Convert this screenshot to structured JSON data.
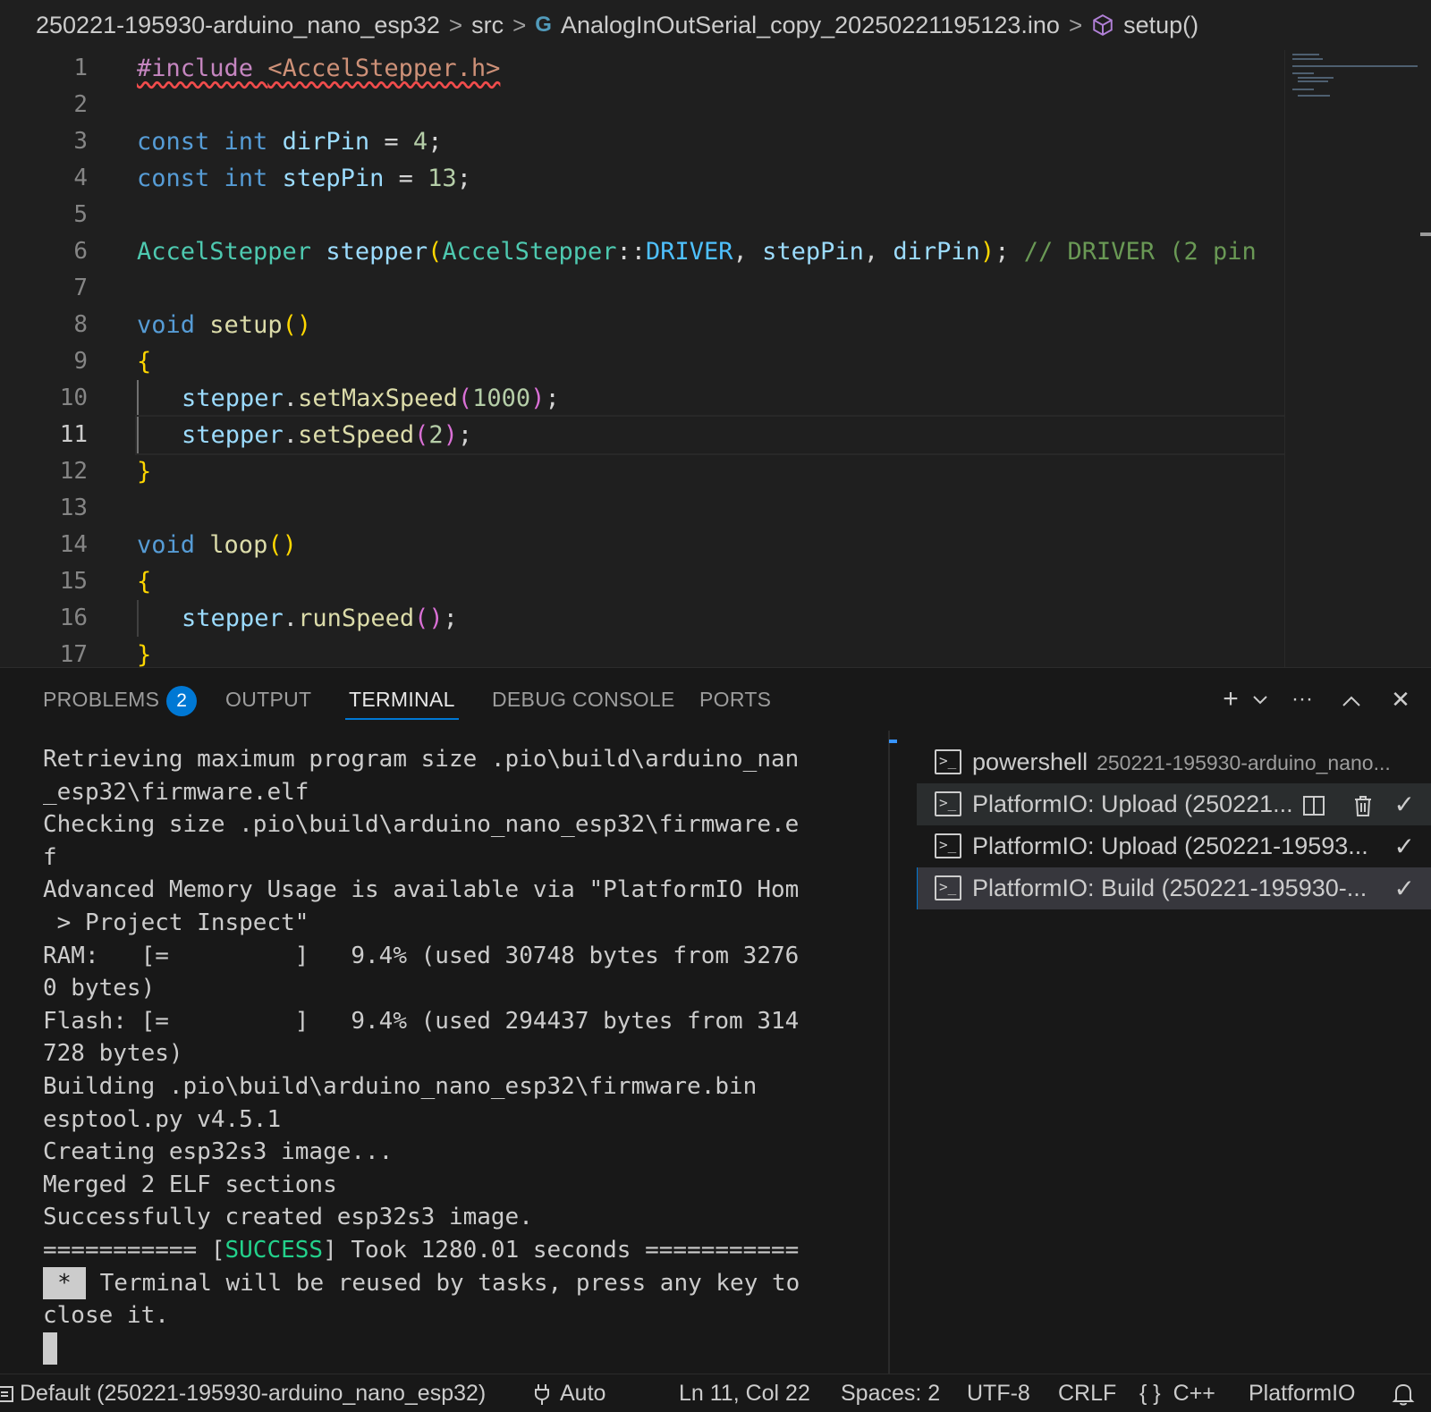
{
  "breadcrumb": {
    "folder": "250221-195930-arduino_nano_esp32",
    "src": "src",
    "file": "AnalogInOutSerial_copy_20250221195123.ino",
    "symbol": "setup()",
    "separator": ">"
  },
  "editor": {
    "line_numbers": [
      "1",
      "2",
      "3",
      "4",
      "5",
      "6",
      "7",
      "8",
      "9",
      "10",
      "11",
      "12",
      "13",
      "14",
      "15",
      "16",
      "17"
    ],
    "active_line": "11",
    "include_directive": "#include",
    "include_file": "<AccelStepper.h>",
    "kw_const": "const",
    "kw_int": "int",
    "kw_void": "void",
    "dirPin": "dirPin",
    "stepPin": "stepPin",
    "dirPin_value": "4",
    "stepPin_value": "13",
    "class_name": "AccelStepper",
    "instance": "stepper",
    "enum_driver": "DRIVER",
    "comment": "// DRIVER (2 pin",
    "setup_fn": "setup",
    "loop_fn": "loop",
    "setMaxSpeed": "setMaxSpeed",
    "max_speed_value": "1000",
    "setSpeed": "setSpeed",
    "speed_value": "2",
    "runSpeed": "runSpeed"
  },
  "panel": {
    "tabs": [
      {
        "label": "PROBLEMS",
        "badge": "2"
      },
      {
        "label": "OUTPUT"
      },
      {
        "label": "TERMINAL"
      },
      {
        "label": "DEBUG CONSOLE"
      },
      {
        "label": "PORTS"
      }
    ],
    "active_tab": "TERMINAL",
    "tools": {
      "add": "+",
      "dropdown": "⌄",
      "more": "···",
      "maximize": "^",
      "close": "✕"
    }
  },
  "terminal": {
    "lines": [
      "Retrieving maximum program size .pio\\build\\arduino_nan",
      "_esp32\\firmware.elf",
      "Checking size .pio\\build\\arduino_nano_esp32\\firmware.e",
      "f",
      "Advanced Memory Usage is available via \"PlatformIO Hom",
      " > Project Inspect\"",
      "RAM:   [=         ]   9.4% (used 30748 bytes from 3276",
      "0 bytes)",
      "Flash: [=         ]   9.4% (used 294437 bytes from 314",
      "728 bytes)",
      "Building .pio\\build\\arduino_nano_esp32\\firmware.bin",
      "esptool.py v4.5.1",
      "Creating esp32s3 image...",
      "Merged 2 ELF sections",
      "Successfully created esp32s3 image."
    ],
    "success_prefix": "=========== [",
    "success_word": "SUCCESS",
    "success_suffix": "] Took 1280.01 seconds ===========",
    "reuse_star": "*",
    "reuse_line1": " Terminal will be reused by tasks, press any key to",
    "reuse_line2": "close it."
  },
  "terminal_list": [
    {
      "name": "powershell",
      "desc": "250221-195930-arduino_nano..."
    },
    {
      "name": "PlatformIO: Upload (250221...",
      "desc": ""
    },
    {
      "name": "PlatformIO: Upload (250221-19593...",
      "desc": ""
    },
    {
      "name": "PlatformIO: Build (250221-195930-...",
      "desc": ""
    }
  ],
  "statusbar": {
    "remote": "Default (250221-195930-arduino_nano_esp32)",
    "port": "Auto",
    "position": "Ln 11, Col 22",
    "spaces": "Spaces: 2",
    "encoding": "UTF-8",
    "eol": "CRLF",
    "language": "C++",
    "platform": "PlatformIO"
  },
  "colors": {
    "background": "#1f1f1f",
    "panel_bg": "#181818",
    "accent": "#0078d4",
    "success": "#23d18b",
    "error": "#f14c4c"
  }
}
